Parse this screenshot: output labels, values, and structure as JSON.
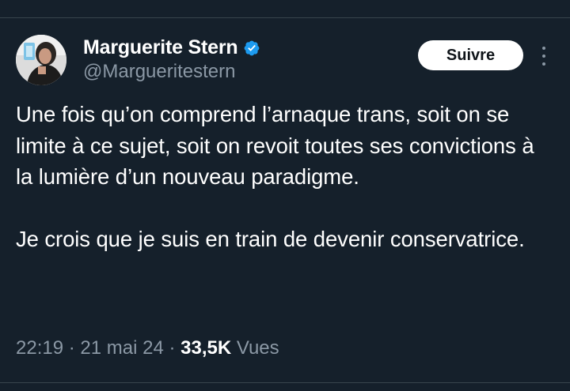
{
  "author": {
    "display_name": "Marguerite Stern",
    "handle": "@Margueritestern",
    "verified": true,
    "verified_color": "#1d9bf0"
  },
  "actions": {
    "follow_label": "Suivre"
  },
  "tweet": {
    "paragraphs": [
      "Une fois qu’on comprend l’arnaque trans, soit on se limite à ce sujet, soit on revoit toutes ses convictions à la lumière d’un nouveau paradigme.",
      "Je crois que je suis en train de devenir conservatrice."
    ]
  },
  "meta": {
    "time": "22:19",
    "separator": " · ",
    "date": "21 mai 24",
    "views_count": "33,5K",
    "views_label": " Vues"
  },
  "icons": {
    "verified": "verified-badge-icon",
    "more": "more-options-icon"
  },
  "colors": {
    "background": "#15202b",
    "secondary_text": "#8b98a5",
    "divider": "#38444d"
  }
}
